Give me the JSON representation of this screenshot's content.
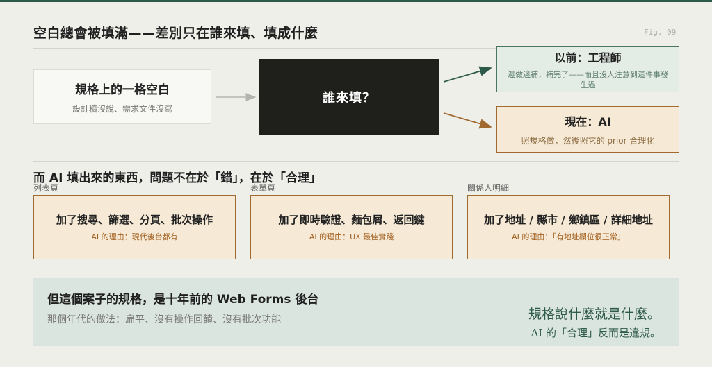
{
  "title": "空白總會被填滿——差別只在誰來填、填成什麼",
  "fig_label": "Fig. 09",
  "source_box": {
    "main": "規格上的一格空白",
    "sub": "設計稿沒說、需求文件沒寫"
  },
  "center_box": {
    "main": "誰來填？"
  },
  "before_box": {
    "main": "以前：工程師",
    "sub": "邊做邊補，補完了——而且沒人注意到這件事發生過"
  },
  "now_box": {
    "main": "現在：AI",
    "sub": "照規格做，然後照它的 prior 合理化"
  },
  "section2_title": "而 AI 填出來的東西，問題不在於「錯」，在於「合理」",
  "cards": [
    {
      "label": "列表頁",
      "main": "加了搜尋、篩選、分頁、批次操作",
      "sub": "AI 的理由：現代後台都有"
    },
    {
      "label": "表單頁",
      "main": "加了即時驗證、麵包屑、返回鍵",
      "sub": "AI 的理由：UX 最佳實踐"
    },
    {
      "label": "關係人明細",
      "main": "加了地址 / 縣市 / 鄉鎮區 / 詳細地址",
      "sub": "AI 的理由：「有地址欄位很正常」"
    }
  ],
  "bottom": {
    "main": "但這個案子的規格，是十年前的 Web Forms 後台",
    "sub": "那個年代的做法：扁平、沒有操作回饋、沒有批次功能",
    "quote_line1": "規格說什麼就是什麼。",
    "quote_line2": "AI 的「合理」反而是違規。"
  },
  "colors": {
    "accent_green": "#2e5a4a",
    "accent_brown": "#a06a30",
    "card_fill": "#f6ead6",
    "bottom_fill": "#dbe5df"
  }
}
